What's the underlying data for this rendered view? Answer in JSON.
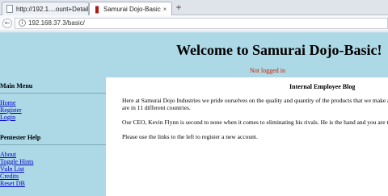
{
  "browser": {
    "tabs": [
      {
        "label": "http://192.1....ount+Details",
        "active": false
      },
      {
        "label": "Samurai Dojo-Basic Ho...",
        "active": true
      }
    ],
    "new_tab_glyph": "+",
    "close_glyph": "×",
    "url": "192.168.37.3/basic/"
  },
  "header": {
    "title": "Welcome to Samurai Dojo-Basic!",
    "login_status": "Not logged in"
  },
  "sidebar": {
    "main_menu": {
      "heading": "Main Menu",
      "links": [
        "Home",
        "Register",
        "Login"
      ]
    },
    "pentester_help": {
      "heading": "Pentester Help",
      "links": [
        "About",
        "Toggle Hints",
        "Vuln List",
        "Credits",
        "Reset DB"
      ]
    }
  },
  "content": {
    "title": "Internal Employee Blog",
    "paragraphs": [
      "Here at Samurai Dojo Industries we pride ourselves on the quality and quantity of the products that we make an",
      "are in 11 different countries.",
      "Our CEO, Kevin Flynn is second to none when it comes to eliminating his rivals. He is the hand and you are the",
      "Please use the links to the left to register a new account."
    ]
  },
  "colors": {
    "page_background": "#add8e6",
    "content_background": "#ffffff",
    "link": "#0000cc",
    "login_status": "#cc2200"
  }
}
